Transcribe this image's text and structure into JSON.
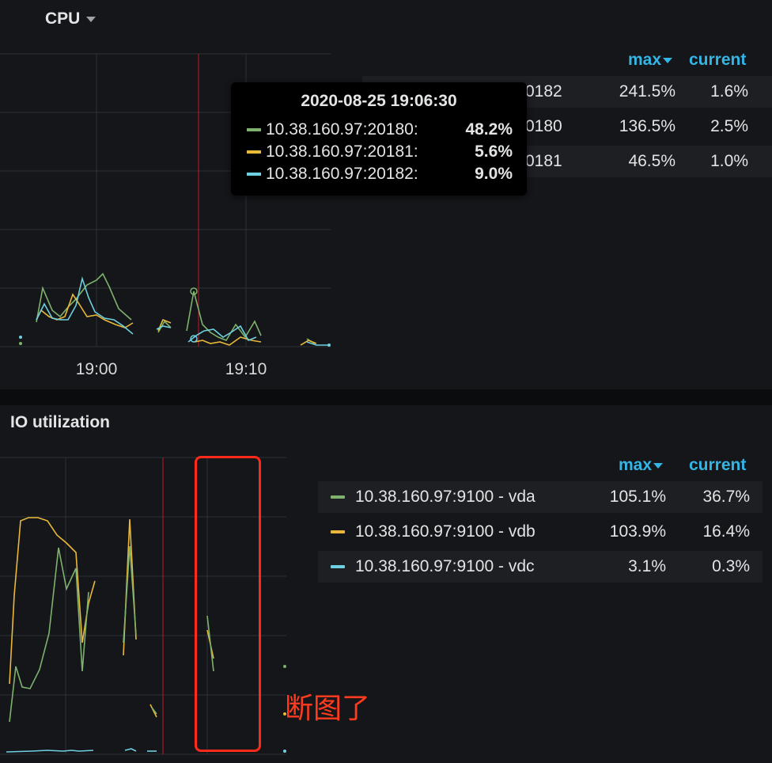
{
  "colors": {
    "series_green": "#7eb26d",
    "series_yellow": "#eab839",
    "series_cyan": "#6ed0e0",
    "accent_blue": "#33b5e5",
    "annotation_red": "#ff2a1a",
    "cursor_red": "#c4162a"
  },
  "cpu_panel": {
    "title": "CPU",
    "title_icon": "chevron-down-icon",
    "x_ticks": [
      "19:00",
      "19:10"
    ],
    "legend": {
      "col_max": "max",
      "col_current": "current",
      "rows": [
        {
          "name": "0182",
          "max": "241.5%",
          "current": "1.6%"
        },
        {
          "name": "0180",
          "max": "136.5%",
          "current": "2.5%"
        },
        {
          "name": "0181",
          "max": "46.5%",
          "current": "1.0%"
        }
      ]
    },
    "tooltip": {
      "time": "2020-08-25 19:06:30",
      "rows": [
        {
          "name": "10.38.160.97:20180:",
          "value": "48.2%",
          "color": "#7eb26d"
        },
        {
          "name": "10.38.160.97:20181:",
          "value": "5.6%",
          "color": "#eab839"
        },
        {
          "name": "10.38.160.97:20182:",
          "value": "9.0%",
          "color": "#6ed0e0"
        }
      ]
    }
  },
  "io_panel": {
    "title": "IO utilization",
    "legend": {
      "col_max": "max",
      "col_current": "current",
      "rows": [
        {
          "name": "10.38.160.97:9100 - vda",
          "max": "105.1%",
          "current": "36.7%",
          "color": "#7eb26d"
        },
        {
          "name": "10.38.160.97:9100 - vdb",
          "max": "103.9%",
          "current": "16.4%",
          "color": "#eab839"
        },
        {
          "name": "10.38.160.97:9100 - vdc",
          "max": "3.1%",
          "current": "0.3%",
          "color": "#6ed0e0"
        }
      ]
    }
  },
  "annotation": {
    "text": "断图了"
  }
}
